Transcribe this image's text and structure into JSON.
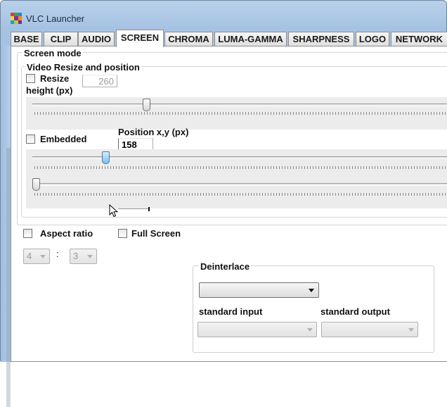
{
  "window": {
    "title": "VLC Launcher"
  },
  "tabs": [
    {
      "label": "BASE"
    },
    {
      "label": "CLIP"
    },
    {
      "label": "AUDIO"
    },
    {
      "label": "SCREEN",
      "active": true
    },
    {
      "label": "CHROMA"
    },
    {
      "label": "LUMA-GAMMA"
    },
    {
      "label": "SHARPNESS"
    },
    {
      "label": "LOGO"
    },
    {
      "label": "NETWORK"
    }
  ],
  "screen": {
    "screen_mode_label": "Screen mode",
    "video_resize_label": "Video Resize and position",
    "resize_label": "Resize",
    "height_label": "height (px)",
    "height_value": "260",
    "height_slider_fraction": 0.27,
    "embedded_label": "Embedded",
    "position_label": "Position x,y (px)",
    "position_x_value": "158",
    "position_x_slider_fraction": 0.17,
    "position_y_slider_fraction": 0.0,
    "aspect_ratio_label": "Aspect ratio",
    "full_screen_label": "Full Screen",
    "aspect_w": "4",
    "aspect_separator": ":",
    "aspect_h": "3",
    "deinterlace_label": "Deinterlace",
    "deinterlace_value": "",
    "standard_input_label": "standard input",
    "standard_output_label": "standard output",
    "standard_input_value": "",
    "standard_output_value": ""
  },
  "icon_colors": [
    "#e53935",
    "#43a047",
    "#1e88e5",
    "#fdd835",
    "#8e24aa",
    "#fb8c00",
    "#00acc1",
    "#c0ca33",
    "#5e35b1"
  ]
}
